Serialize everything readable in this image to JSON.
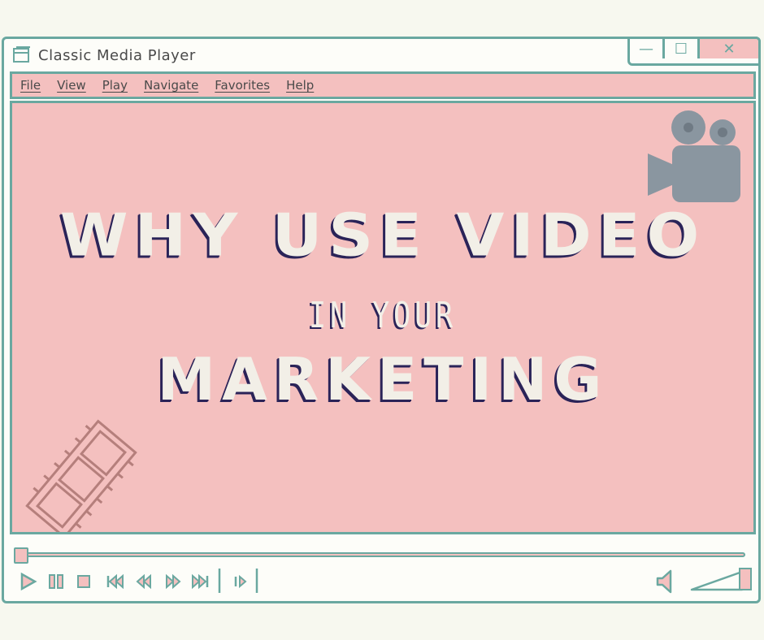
{
  "window": {
    "title": "Classic Media Player",
    "controls": {
      "minimize": "—",
      "maximize": "☐",
      "close": "✕"
    }
  },
  "menu": {
    "items": [
      {
        "label": "File"
      },
      {
        "label": "View"
      },
      {
        "label": "Play"
      },
      {
        "label": "Navigate"
      },
      {
        "label": "Favorites"
      },
      {
        "label": "Help"
      }
    ]
  },
  "screen": {
    "line1": "WHY USE VIDEO",
    "line2": "IN YOUR",
    "line3": "MARKETING"
  },
  "playback": {
    "progress": 0.0,
    "volume": 1.0
  },
  "colors": {
    "accent": "#6aa8a0",
    "screen": "#f4c0bf",
    "text_fill": "#f2efe7",
    "text_shadow": "#2a2358",
    "camera": "#8a96a0",
    "film": "#b57f7c"
  },
  "icons": [
    "app-window-icon",
    "camera-icon",
    "filmstrip-icon",
    "play-icon",
    "pause-icon",
    "stop-icon",
    "skip-back-icon",
    "rewind-icon",
    "fast-forward-icon",
    "skip-forward-icon",
    "frame-step-icon",
    "volume-icon",
    "volume-slider-icon"
  ]
}
